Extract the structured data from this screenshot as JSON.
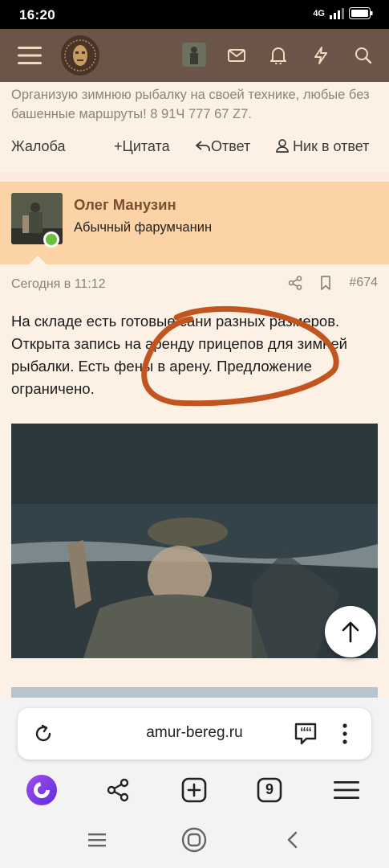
{
  "status_bar": {
    "time": "16:20",
    "network": "4G",
    "signal": "signal-icon",
    "battery": "battery-icon"
  },
  "top_nav": {
    "menu": "menu-icon",
    "logo": "forum-logo",
    "avatar": "user-avatar",
    "mail": "mail-icon",
    "bell": "bell-icon",
    "flash": "lightning-icon",
    "search": "search-icon",
    "background": "#6b5548"
  },
  "prev_post": {
    "text": "Организую зимнюю рыбалку на своей технике, любые без башенные маршруты! 8 91Ч 777 67 Z7.",
    "actions": {
      "report": "Жалоба",
      "quote": "Цитата",
      "reply": "Ответ",
      "nick": "Ник в ответ"
    }
  },
  "post": {
    "author_name": "Олег Манузин",
    "author_title": "Абычный фарумчанин",
    "date": "Сегодня в 11:12",
    "number": "#674",
    "body": "На складе есть готовые сани разных размеров. Открыта запись на аренду прицепов для зимней рыбалки. Есть фены в арену. Предложение ограничено.",
    "annotation_color": "#c2551f",
    "header_color": "#fbd3a6",
    "name_color": "#7d4e2f"
  },
  "browser": {
    "url": "amur-bereg.ru",
    "tabs_count": "9",
    "icons": [
      "reload-icon",
      "chat-icon",
      "more-icon",
      "alice-icon",
      "share-icon",
      "add-tab-icon",
      "tabs-icon",
      "menu-icon"
    ]
  },
  "system_nav": [
    "recents-icon",
    "home-icon",
    "back-icon"
  ]
}
